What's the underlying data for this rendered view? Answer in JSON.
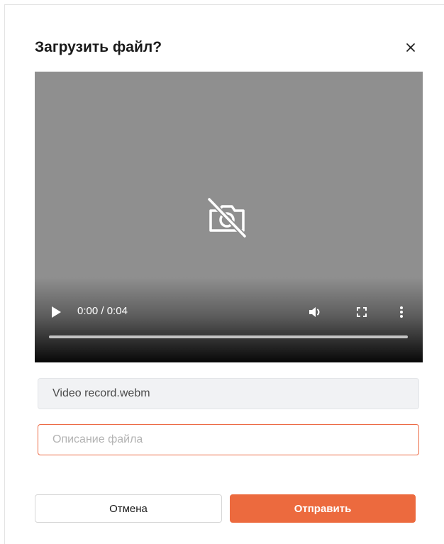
{
  "dialog": {
    "title": "Загрузить файл?",
    "close_icon": "close-icon"
  },
  "video": {
    "placeholder_icon": "no-camera-icon",
    "current_time": "0:00",
    "duration": "0:04",
    "time_display": "0:00 / 0:04",
    "progress": 0,
    "controls": [
      "play-icon",
      "volume-icon",
      "fullscreen-icon",
      "more-vertical-icon"
    ]
  },
  "fields": {
    "filename_value": "Video record.webm",
    "description_placeholder": "Описание файла",
    "description_value": ""
  },
  "buttons": {
    "cancel_label": "Отмена",
    "send_label": "Отправить"
  },
  "colors": {
    "accent": "#ec6a3e",
    "video_bg": "#8f8f8f"
  }
}
